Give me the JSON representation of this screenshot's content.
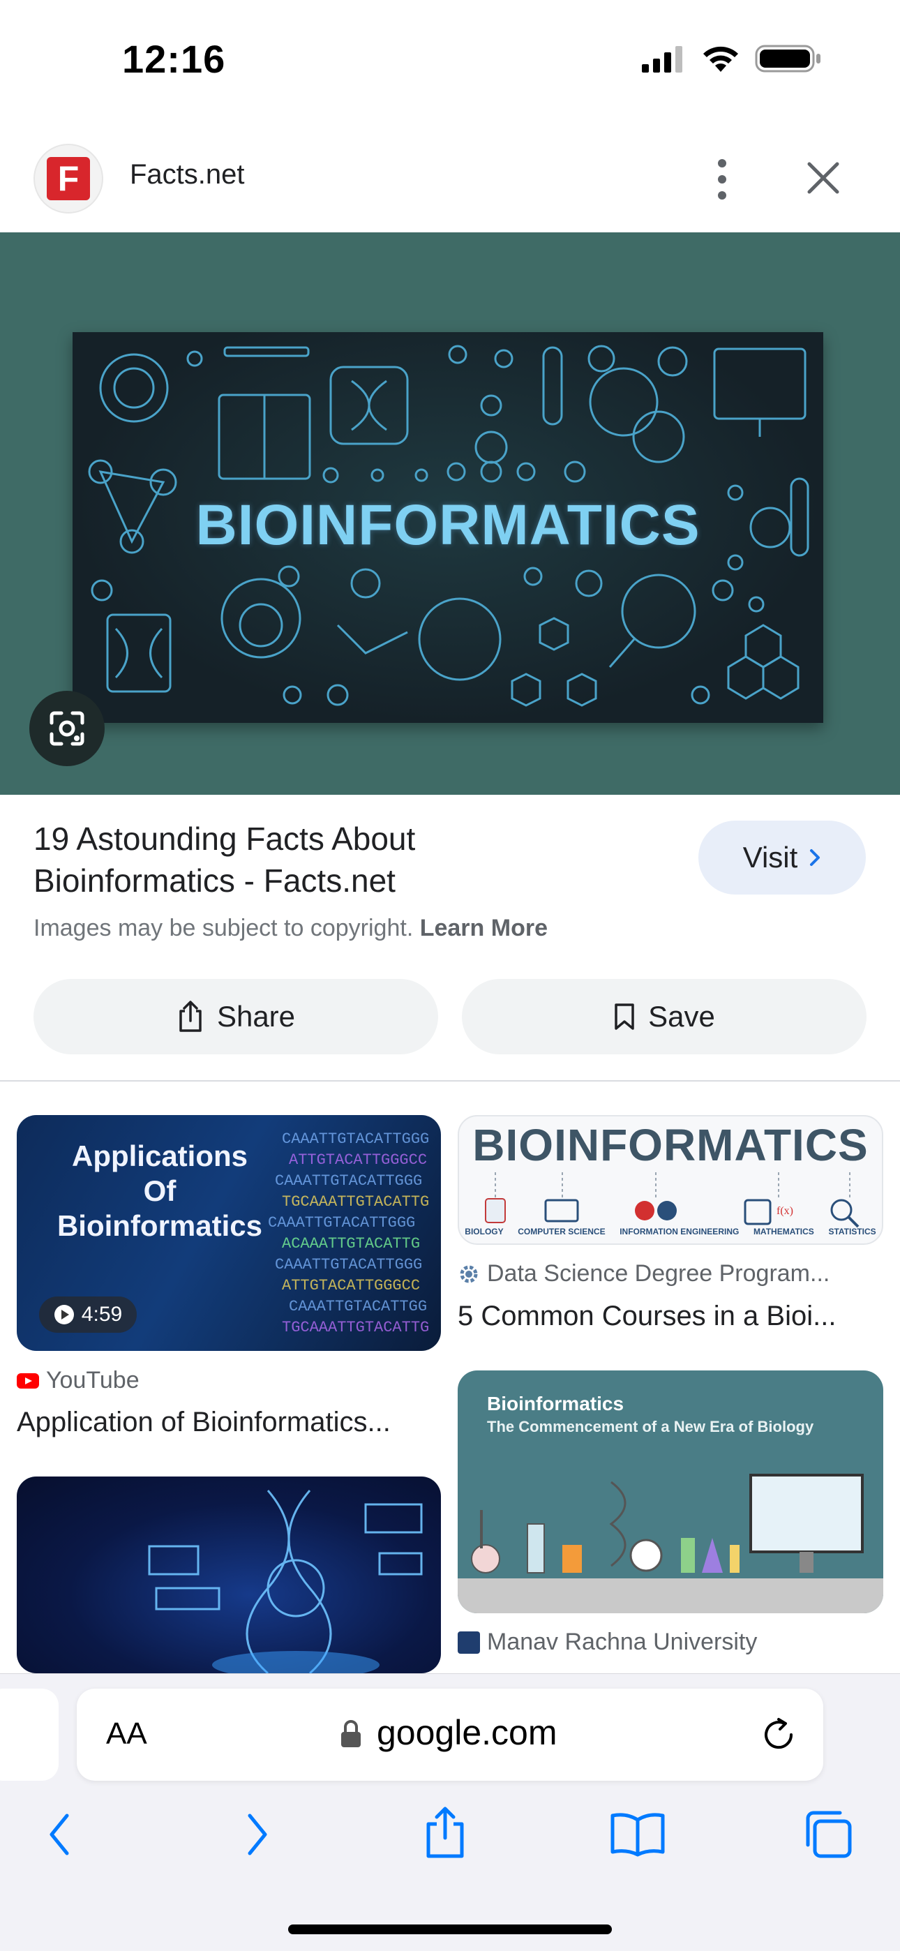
{
  "status_bar": {
    "time": "12:16"
  },
  "header": {
    "site_name": "Facts.net",
    "logo_letter": "F"
  },
  "hero": {
    "title": "BIOINFORMATICS",
    "background": "#3f6b66"
  },
  "result": {
    "title_line1": "19 Astounding Facts About",
    "title_line2": "Bioinformatics - Facts.net",
    "visit_label": "Visit",
    "copyright_text": "Images may be subject to copyright.",
    "learn_more": "Learn More",
    "share_label": "Share",
    "save_label": "Save"
  },
  "grid": {
    "items": [
      {
        "thumb_line1": "Applications",
        "thumb_line2": "Of",
        "thumb_line3": "Bioinformatics",
        "duration": "4:59",
        "source": "YouTube",
        "caption": "Application of Bioinformatics..."
      },
      {
        "thumb_title": "BIOINFORMATICS",
        "source": "Data Science Degree Program...",
        "caption": "5 Common Courses in a Bioi..."
      },
      {
        "thumb_line1": "Bioinformatics",
        "thumb_line2": "The Commencement of a New Era of Biology",
        "source": "Manav Rachna University"
      }
    ],
    "t2_labels": [
      "BIOLOGY",
      "COMPUTER SCIENCE",
      "INFORMATION ENGINEERING",
      "MATHEMATICS",
      "STATISTICS"
    ]
  },
  "browser": {
    "aa_label": "AA",
    "domain": "google.com"
  },
  "colors": {
    "accent_blue": "#007aff",
    "visit_bg": "#e8eef9"
  }
}
